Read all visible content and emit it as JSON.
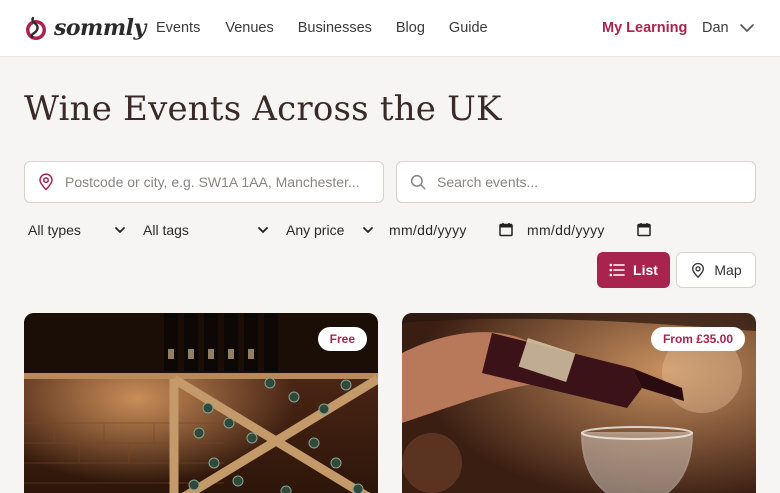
{
  "header": {
    "logo_text": "sommly",
    "nav": [
      "Events",
      "Venues",
      "Businesses",
      "Blog",
      "Guide"
    ],
    "my_learning": "My Learning",
    "user_name": "Dan"
  },
  "page": {
    "title": "Wine Events Across the UK"
  },
  "search": {
    "location_placeholder": "Postcode or city, e.g. SW1A 1AA, Manchester...",
    "events_placeholder": "Search events..."
  },
  "filters": {
    "type": "All types",
    "tags": "All tags",
    "price": "Any price",
    "date_from": "mm/dd/yyyy",
    "date_to": "mm/dd/yyyy"
  },
  "view_toggle": {
    "list_label": "List",
    "map_label": "Map"
  },
  "events": [
    {
      "price_badge": "Free",
      "image": "wine-cellar-rack"
    },
    {
      "price_badge": "From £35.00",
      "image": "wine-pouring-glass"
    }
  ],
  "colors": {
    "accent": "#a8244f",
    "background": "#f7f5f3"
  }
}
